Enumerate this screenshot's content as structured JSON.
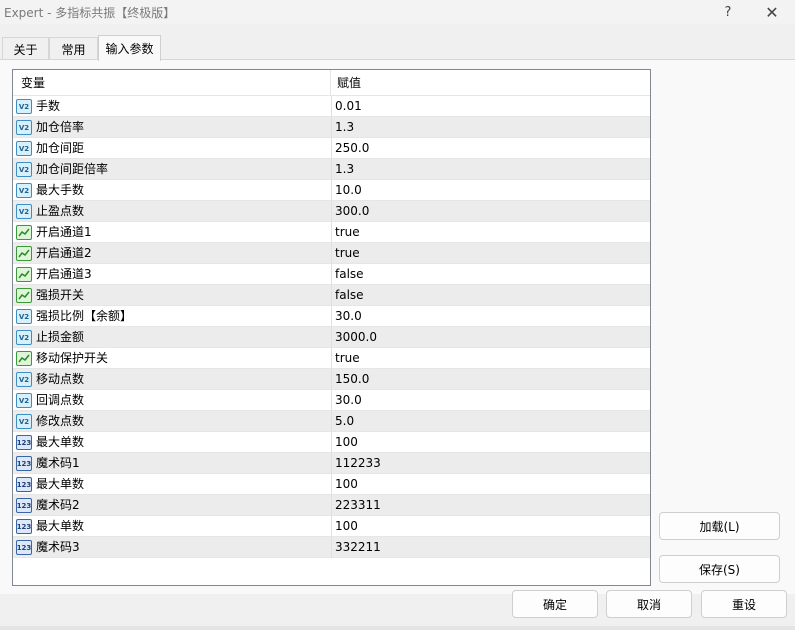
{
  "window": {
    "title": "Expert - 多指标共振【终极版】",
    "help_label": "?",
    "close_label": "✕"
  },
  "tabs": [
    {
      "label": "关于",
      "active": false
    },
    {
      "label": "常用",
      "active": false
    },
    {
      "label": "输入参数",
      "active": true
    }
  ],
  "table": {
    "headers": {
      "variable": "变量",
      "value": "赋值"
    },
    "rows": [
      {
        "type": "double",
        "icon_text": "V2",
        "name": "手数",
        "value": "0.01"
      },
      {
        "type": "double",
        "icon_text": "V2",
        "name": "加仓倍率",
        "value": "1.3"
      },
      {
        "type": "double",
        "icon_text": "V2",
        "name": "加仓间距",
        "value": "250.0"
      },
      {
        "type": "double",
        "icon_text": "V2",
        "name": "加仓间距倍率",
        "value": "1.3"
      },
      {
        "type": "double",
        "icon_text": "V2",
        "name": "最大手数",
        "value": "10.0"
      },
      {
        "type": "double",
        "icon_text": "V2",
        "name": "止盈点数",
        "value": "300.0"
      },
      {
        "type": "bool",
        "icon_text": "",
        "name": "开启通道1",
        "value": "true"
      },
      {
        "type": "bool",
        "icon_text": "",
        "name": "开启通道2",
        "value": "true"
      },
      {
        "type": "bool",
        "icon_text": "",
        "name": "开启通道3",
        "value": "false"
      },
      {
        "type": "bool",
        "icon_text": "",
        "name": "强损开关",
        "value": "false"
      },
      {
        "type": "double",
        "icon_text": "V2",
        "name": "强损比例【余额】",
        "value": "30.0"
      },
      {
        "type": "double",
        "icon_text": "V2",
        "name": "止损金额",
        "value": "3000.0"
      },
      {
        "type": "bool",
        "icon_text": "",
        "name": "移动保护开关",
        "value": "true"
      },
      {
        "type": "double",
        "icon_text": "V2",
        "name": "移动点数",
        "value": "150.0"
      },
      {
        "type": "double",
        "icon_text": "V2",
        "name": "回调点数",
        "value": "30.0"
      },
      {
        "type": "double",
        "icon_text": "V2",
        "name": "修改点数",
        "value": "5.0"
      },
      {
        "type": "int",
        "icon_text": "123",
        "name": "最大单数",
        "value": "100"
      },
      {
        "type": "int",
        "icon_text": "123",
        "name": "魔术码1",
        "value": "112233"
      },
      {
        "type": "int",
        "icon_text": "123",
        "name": "最大单数",
        "value": "100"
      },
      {
        "type": "int",
        "icon_text": "123",
        "name": "魔术码2",
        "value": "223311"
      },
      {
        "type": "int",
        "icon_text": "123",
        "name": "最大单数",
        "value": "100"
      },
      {
        "type": "int",
        "icon_text": "123",
        "name": "魔术码3",
        "value": "332211"
      }
    ]
  },
  "buttons": {
    "load": "加载(L)",
    "save": "保存(S)",
    "ok": "确定",
    "cancel": "取消",
    "reset": "重设"
  }
}
